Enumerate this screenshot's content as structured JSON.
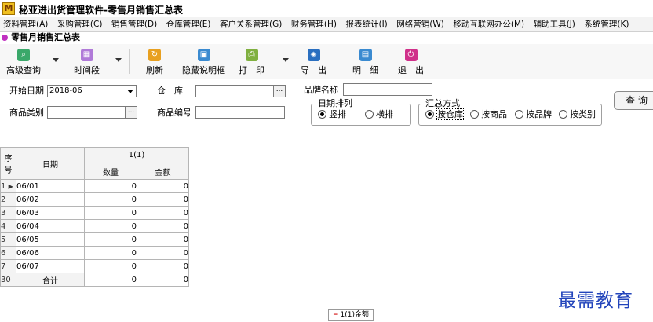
{
  "app": {
    "title": "秘亚进出货管理软件-零售月销售汇总表",
    "logo_icon": "app-logo-icon"
  },
  "menu": [
    "资料管理(A)",
    "采购管理(C)",
    "销售管理(D)",
    "仓库管理(E)",
    "客户关系管理(G)",
    "财务管理(H)",
    "报表统计(I)",
    "网络营销(W)",
    "移动互联网办公(M)",
    "辅助工具(J)",
    "系统管理(K)"
  ],
  "subwindow": {
    "title": "零售月销售汇总表"
  },
  "toolbar": {
    "advanced_query": "高级查询",
    "time_period": "时间段",
    "refresh": "刷新",
    "hide_notes": "隐藏说明框",
    "print": "打　印",
    "export": "导　出",
    "detail": "明　细",
    "exit": "退　出"
  },
  "form": {
    "start_date_label": "开始日期",
    "start_date_value": "2018-06",
    "warehouse_label": "仓　库",
    "warehouse_value": "",
    "brand_label": "品牌名称",
    "brand_value": "",
    "category_label": "商品类别",
    "category_value": "",
    "code_label": "商品编号",
    "code_value": "",
    "date_sort": {
      "label": "日期排列",
      "options": [
        "竖排",
        "横排"
      ],
      "selected": "竖排"
    },
    "summary_mode": {
      "label": "汇总方式",
      "options": [
        "按仓库",
        "按商品",
        "按品牌",
        "按类别"
      ],
      "selected": "按仓库"
    },
    "query_button": "查询"
  },
  "grid": {
    "col_seq": "序号",
    "col_date": "日期",
    "group_header": "1(1)",
    "col_qty": "数量",
    "col_amount": "金额",
    "rows": [
      {
        "seq": "1",
        "date": "06/01",
        "qty": "0",
        "amount": "0"
      },
      {
        "seq": "2",
        "date": "06/02",
        "qty": "0",
        "amount": "0"
      },
      {
        "seq": "3",
        "date": "06/03",
        "qty": "0",
        "amount": "0"
      },
      {
        "seq": "4",
        "date": "06/04",
        "qty": "0",
        "amount": "0"
      },
      {
        "seq": "5",
        "date": "06/05",
        "qty": "0",
        "amount": "0"
      },
      {
        "seq": "6",
        "date": "06/06",
        "qty": "0",
        "amount": "0"
      },
      {
        "seq": "7",
        "date": "06/07",
        "qty": "0",
        "amount": "0"
      }
    ],
    "total_seq": "30",
    "total_label": "合计",
    "total_qty": "0",
    "total_amount": "0"
  },
  "bottom_tab": {
    "label": "1(1)金额"
  },
  "watermark": "最需教育",
  "colors": {
    "menubar": "#f3f3f3",
    "toolbar": "#f7f7f7",
    "accent": "#c030c0",
    "watermark": "#2244bb"
  }
}
